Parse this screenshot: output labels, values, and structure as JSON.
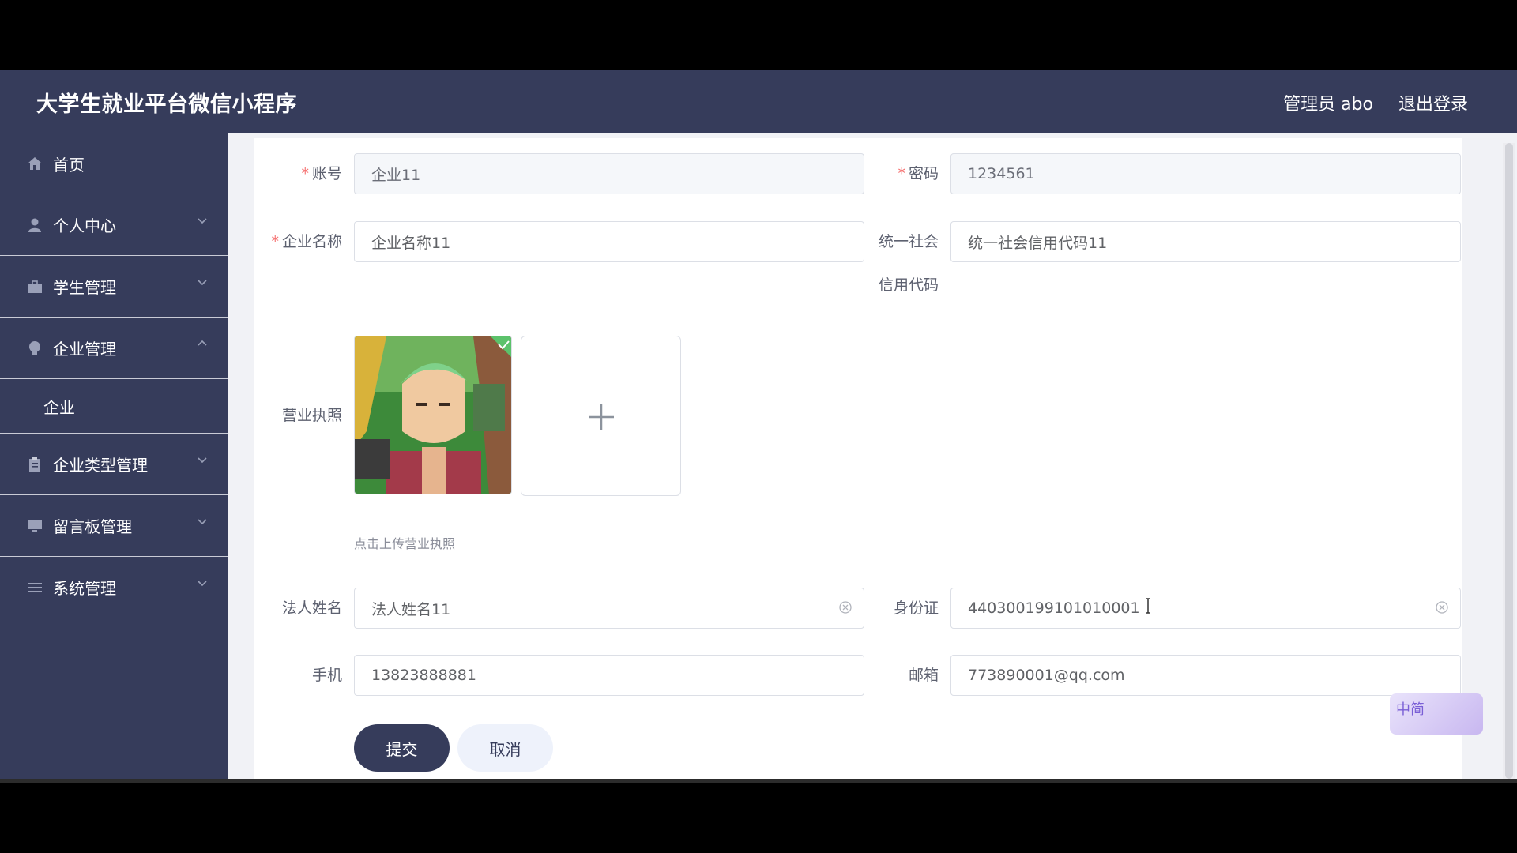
{
  "header": {
    "brand": "大学生就业平台微信小程序",
    "admin": "管理员 abo",
    "logout": "退出登录"
  },
  "sidebar": {
    "items": [
      {
        "label": "首页",
        "icon": "home-icon"
      },
      {
        "label": "个人中心",
        "icon": "user-icon"
      },
      {
        "label": "学生管理",
        "icon": "briefcase-icon"
      },
      {
        "label": "企业管理",
        "icon": "bulb-icon"
      },
      {
        "label": "企业类型管理",
        "icon": "clipboard-icon"
      },
      {
        "label": "留言板管理",
        "icon": "monitor-icon"
      },
      {
        "label": "系统管理",
        "icon": "list-icon"
      }
    ],
    "submenu": "企业"
  },
  "form": {
    "account": {
      "label": "账号",
      "value": "企业11"
    },
    "password": {
      "label": "密码",
      "value": "1234561"
    },
    "company_name": {
      "label": "企业名称",
      "value": "企业名称11"
    },
    "credit_code": {
      "label_line1": "统一社会",
      "label_line2": "信用代码",
      "value": "统一社会信用代码11"
    },
    "license": {
      "label": "营业执照",
      "hint": "点击上传营业执照"
    },
    "legal_name": {
      "label": "法人姓名",
      "value": "法人姓名11"
    },
    "id_card": {
      "label": "身份证",
      "value": "440300199101010001"
    },
    "phone": {
      "label": "手机",
      "value": "13823888881"
    },
    "email": {
      "label": "邮箱",
      "value": "773890001@qq.com"
    },
    "submit": "提交",
    "cancel": "取消",
    "required_mark": "*"
  },
  "widget": {
    "label": "中简"
  }
}
